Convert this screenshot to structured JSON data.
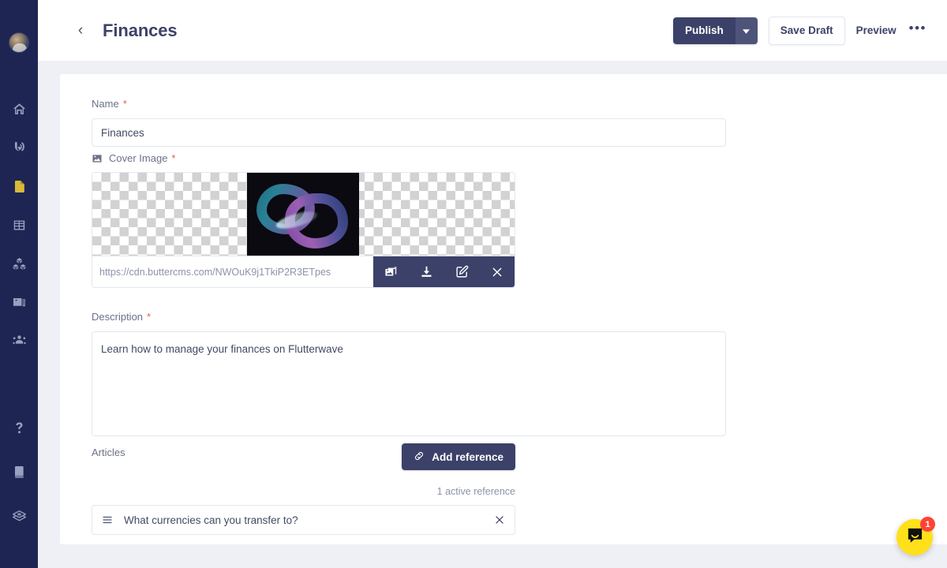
{
  "sidebar": {
    "avatar_name": "user-avatar",
    "items": [
      {
        "name": "home",
        "icon": "home-icon",
        "active": false
      },
      {
        "name": "blog",
        "icon": "broadcast-icon",
        "active": false
      },
      {
        "name": "pages",
        "icon": "document-icon",
        "active": true
      },
      {
        "name": "collections",
        "icon": "table-icon",
        "active": false
      },
      {
        "name": "components",
        "icon": "blocks-icon",
        "active": false
      },
      {
        "name": "media",
        "icon": "media-icon",
        "active": false
      },
      {
        "name": "team",
        "icon": "users-icon",
        "active": false
      }
    ],
    "bottom_items": [
      {
        "name": "help",
        "icon": "question-mark-icon"
      },
      {
        "name": "docs",
        "icon": "book-icon"
      },
      {
        "name": "stack",
        "icon": "layers-icon"
      }
    ]
  },
  "header": {
    "back_label": "‹",
    "title": "Finances",
    "publish_label": "Publish",
    "publish_caret": "▾",
    "save_draft_label": "Save Draft",
    "preview_label": "Preview",
    "more_label": "•••"
  },
  "form": {
    "name": {
      "label": "Name",
      "required_mark": "*",
      "value": "Finances",
      "placeholder": ""
    },
    "cover_image": {
      "label": "Cover Image",
      "required_mark": "*",
      "url": "https://cdn.buttercms.com/NWOuK9j1TkiP2R3ETpes",
      "toolbar": [
        {
          "name": "image-library-icon",
          "title": "Library"
        },
        {
          "name": "download-icon",
          "title": "Download"
        },
        {
          "name": "edit-icon",
          "title": "Edit"
        },
        {
          "name": "close-icon",
          "title": "Remove"
        }
      ]
    },
    "description": {
      "label": "Description",
      "required_mark": "*",
      "value": "Learn how to manage your finances on Flutterwave",
      "placeholder": ""
    },
    "articles": {
      "label": "Articles",
      "add_reference_label": "Add reference",
      "active_reference_count": "1 active reference",
      "references": [
        {
          "title": "What currencies can you transfer to?",
          "remove_label": "×"
        }
      ]
    }
  },
  "chat": {
    "badge_count": "1",
    "icon": "chat-bubble-icon"
  },
  "colors": {
    "sidebar_bg": "#1e2553",
    "accent_navy": "#3b4168",
    "page_bg": "#eef0f6",
    "required_red": "#e0614b",
    "active_nav": "#d8b93c",
    "chat_yellow": "#ffe01b",
    "badge_red": "#ff4337"
  }
}
